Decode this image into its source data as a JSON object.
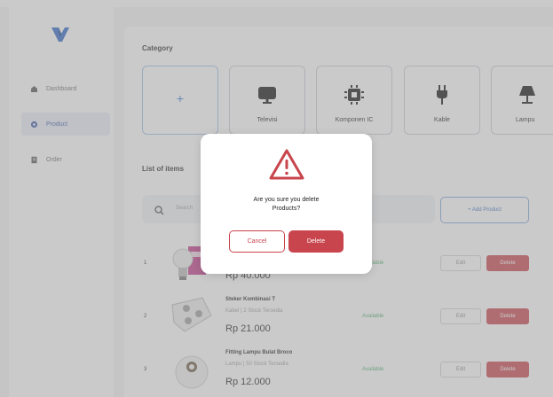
{
  "colors": {
    "accent": "#c8454d",
    "primary": "#3a6fc2",
    "available": "#4caf6e"
  },
  "sidebar": {
    "logo": "y-logo-icon",
    "items": [
      {
        "label": "Dashboard",
        "icon": "dashboard-icon",
        "active": false
      },
      {
        "label": "Product",
        "icon": "product-icon",
        "active": true
      },
      {
        "label": "Order",
        "icon": "order-icon",
        "active": false
      }
    ]
  },
  "category": {
    "title": "Category",
    "add_icon": "+",
    "items": [
      {
        "label": "Televisi",
        "icon": "tv-icon"
      },
      {
        "label": "Komponen IC",
        "icon": "chip-icon"
      },
      {
        "label": "Kable",
        "icon": "plug-icon"
      },
      {
        "label": "Lampu",
        "icon": "lamp-icon"
      }
    ]
  },
  "items": {
    "title": "List of items",
    "search_placeholder": "Search",
    "add_button": "+ Add Product",
    "rows": [
      {
        "num": "1",
        "name": "",
        "meta": "",
        "price": "Rp 40.000",
        "status": "Available",
        "edit": "Edit",
        "delete": "Delete"
      },
      {
        "num": "2",
        "name": "Steker Kombinasi T",
        "meta": "Kabel | 2 Stock Tersedia",
        "price": "Rp 21.000",
        "status": "Available",
        "edit": "Edit",
        "delete": "Delete"
      },
      {
        "num": "3",
        "name": "Fitting Lampu Bulat Broco",
        "meta": "Lampu | 50 Stock Tersedia",
        "price": "Rp 12.000",
        "status": "Available",
        "edit": "Edit",
        "delete": "Delete"
      }
    ]
  },
  "modal": {
    "icon": "warning-icon",
    "message_line1": "Are you sure you delete",
    "message_line2": "Products?",
    "cancel": "Cancel",
    "confirm": "Delete"
  }
}
